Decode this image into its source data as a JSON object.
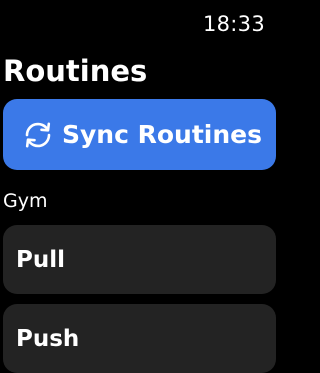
{
  "status_bar": {
    "time": "18:33"
  },
  "header": {
    "title": "Routines"
  },
  "sync_button": {
    "label": "Sync Routines",
    "icon": "sync-arrows-icon",
    "color": "#3b79e8"
  },
  "section": {
    "title": "Gym"
  },
  "routines": [
    {
      "label": "Pull"
    },
    {
      "label": "Push"
    }
  ],
  "colors": {
    "background": "#000000",
    "card": "#232323",
    "accent": "#3b79e8",
    "text": "#ffffff"
  }
}
